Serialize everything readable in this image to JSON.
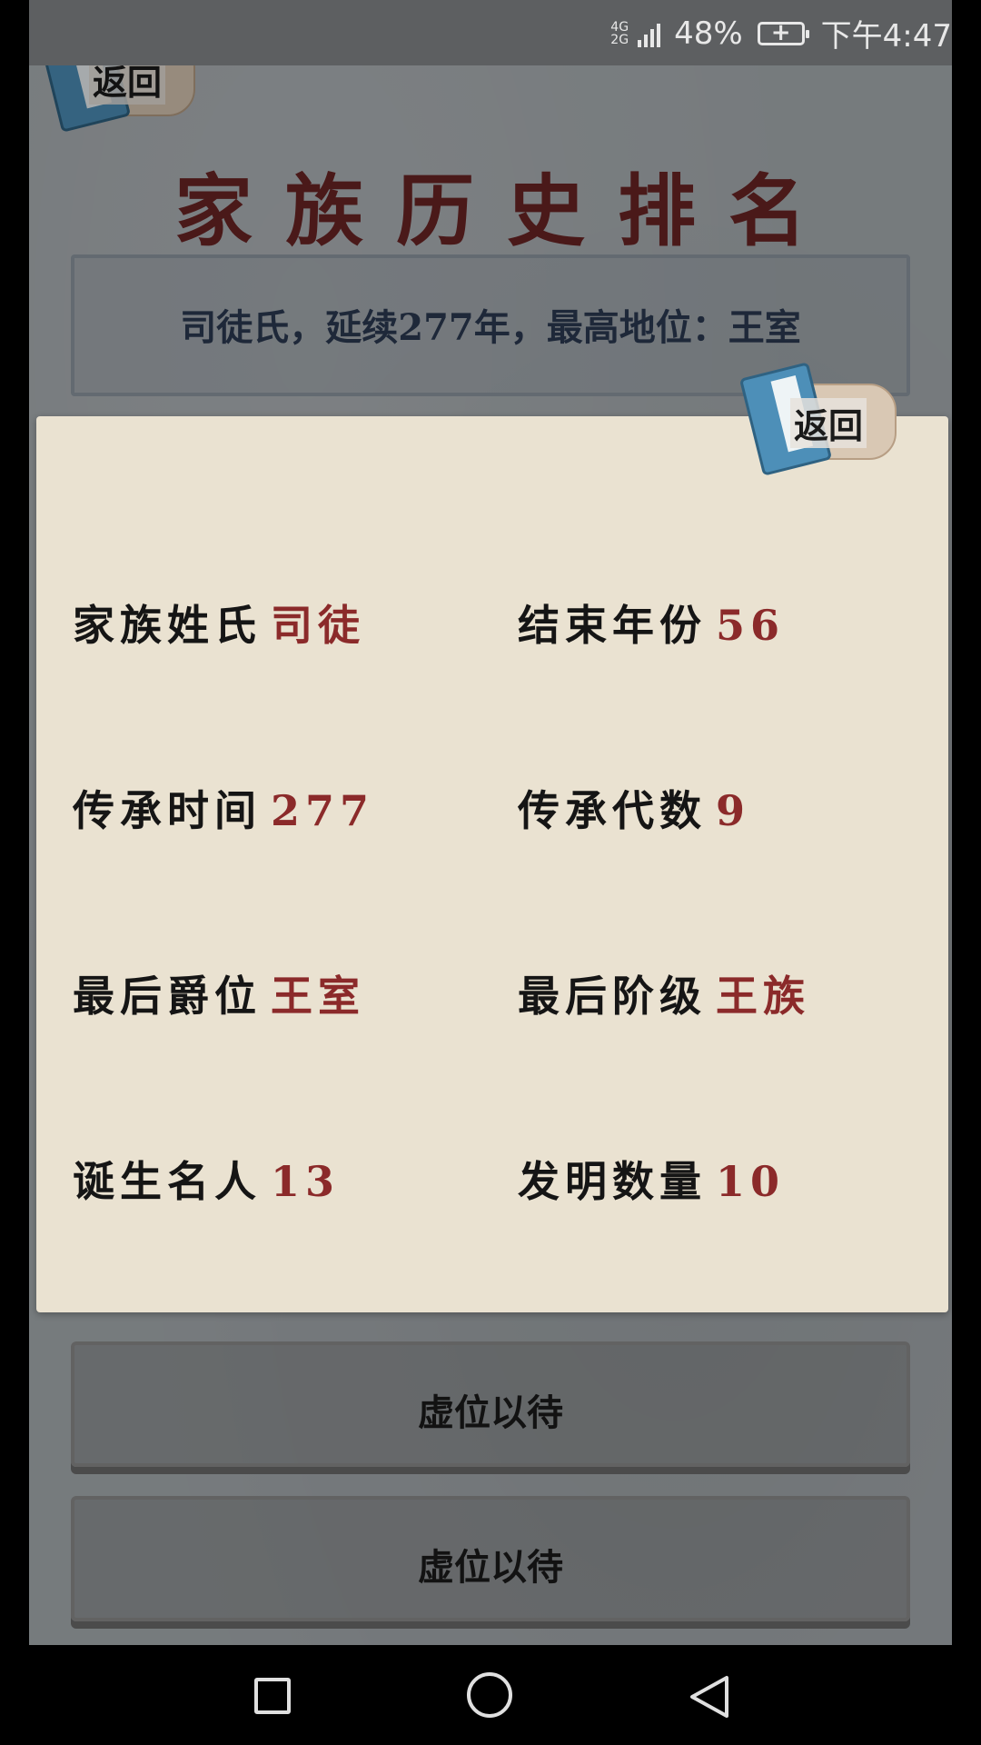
{
  "status_bar": {
    "network_top": "4G",
    "network_bottom": "2G",
    "battery_percent": "48%",
    "time": "下午4:47"
  },
  "back_button_label": "返回",
  "title": "家族历史排名",
  "summary": "司徒氏，延续277年，最高地位：王室",
  "placeholder_rows": [
    "虚位以待",
    "虚位以待"
  ],
  "popup": {
    "back_button_label": "返回",
    "stats": [
      {
        "label": "家族姓氏",
        "value": "司徒"
      },
      {
        "label": "结束年份",
        "value": "56"
      },
      {
        "label": "传承时间",
        "value": "277"
      },
      {
        "label": "传承代数",
        "value": "9"
      },
      {
        "label": "最后爵位",
        "value": "王室"
      },
      {
        "label": "最后阶级",
        "value": "王族"
      },
      {
        "label": "诞生名人",
        "value": "13"
      },
      {
        "label": "发明数量",
        "value": "10"
      }
    ]
  },
  "colors": {
    "title": "#6a2425",
    "value_text": "#8b2a2a",
    "card_bg": "#eae2d1",
    "summary_text": "#2c3a52"
  },
  "icons": {
    "back": "book-scroll-icon",
    "nav_recent": "square-icon",
    "nav_home": "circle-icon",
    "nav_back": "triangle-back-icon"
  }
}
